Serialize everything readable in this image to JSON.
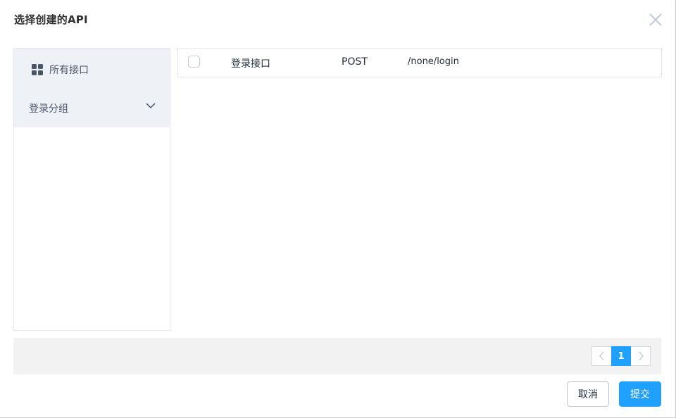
{
  "dialog": {
    "title": "选择创建的API",
    "close_icon": "close-icon"
  },
  "groups": {
    "all_label": "所有接口",
    "all_icon": "grid-icon",
    "items": [
      {
        "label": "登录分组",
        "icon": "chevron-down-icon",
        "expanded": false
      }
    ]
  },
  "apis": [
    {
      "checked": false,
      "name": "登录接口",
      "method": "POST",
      "path": "/none/login"
    }
  ],
  "pagination": {
    "current_page": "1",
    "prev_icon": "chevron-left-icon",
    "next_icon": "chevron-right-icon"
  },
  "footer": {
    "cancel_label": "取消",
    "submit_label": "提交"
  },
  "colors": {
    "accent": "#20a0ff",
    "group_header_bg": "#eef1f6",
    "pager_bar_bg": "#f2f2f2"
  }
}
